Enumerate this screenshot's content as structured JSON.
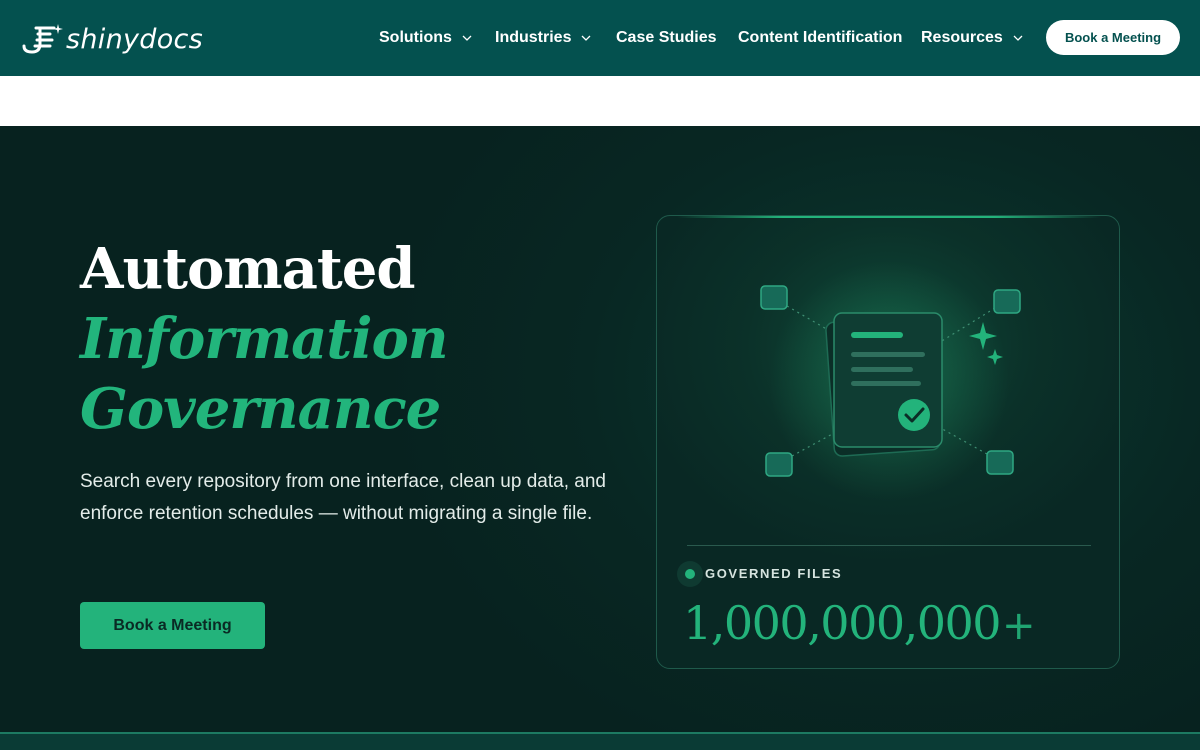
{
  "nav": {
    "logo_text": "shinydocs",
    "items": [
      {
        "label": "Solutions",
        "has_dropdown": true
      },
      {
        "label": "Industries",
        "has_dropdown": true
      },
      {
        "label": "Case Studies",
        "has_dropdown": false
      },
      {
        "label": "Content Identification",
        "has_dropdown": false
      },
      {
        "label": "Resources",
        "has_dropdown": true
      }
    ],
    "cta_label": "Book a Meeting"
  },
  "hero": {
    "title_line1": "Automated",
    "title_line2": "Information",
    "title_line3": "Governance",
    "subtitle": "Search every repository from one interface, clean up data, and enforce retention schedules — without migrating a single file.",
    "cta_label": "Book a Meeting"
  },
  "stat_card": {
    "label": "GOVERNED FILES",
    "value": "1,000,000,000",
    "suffix": "+"
  },
  "colors": {
    "nav_bg": "#04514f",
    "hero_bg": "#082522",
    "accent": "#23b37b",
    "white": "#ffffff"
  },
  "icons": [
    "logo-mark-icon",
    "chevron-down-icon",
    "document-icon",
    "check-circle-icon",
    "sparkle-icon",
    "node-icon"
  ]
}
